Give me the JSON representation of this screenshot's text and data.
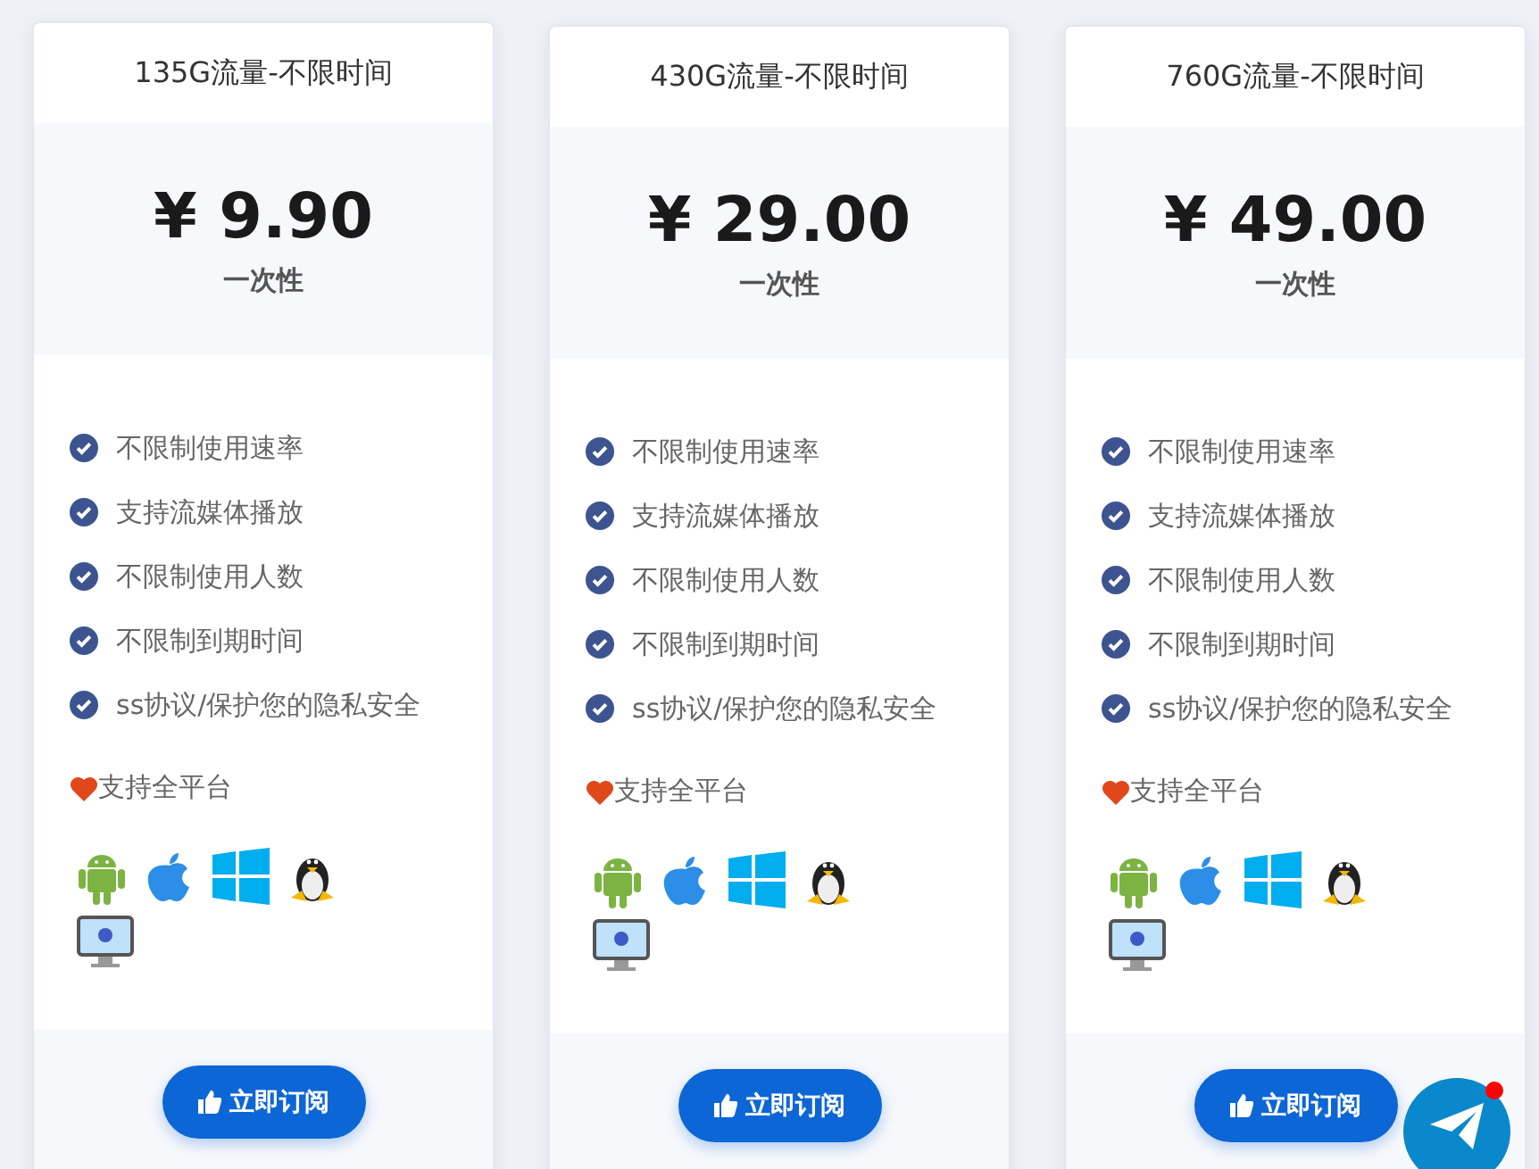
{
  "plans": [
    {
      "title": "135G流量-不限时间",
      "price": "¥ 9.90",
      "period": "一次性",
      "features": [
        "不限制使用速率",
        "支持流媒体播放",
        "不限制使用人数",
        "不限制到期时间",
        "ss协议/保护您的隐私安全"
      ],
      "platform_label": "支持全平台",
      "button": "立即订阅"
    },
    {
      "title": "430G流量-不限时间",
      "price": "¥ 29.00",
      "period": "一次性",
      "features": [
        "不限制使用速率",
        "支持流媒体播放",
        "不限制使用人数",
        "不限制到期时间",
        "ss协议/保护您的隐私安全"
      ],
      "platform_label": "支持全平台",
      "button": "立即订阅"
    },
    {
      "title": "760G流量-不限时间",
      "price": "¥ 49.00",
      "period": "一次性",
      "features": [
        "不限制使用速率",
        "支持流媒体播放",
        "不限制使用人数",
        "不限制到期时间",
        "ss协议/保护您的隐私安全"
      ],
      "platform_label": "支持全平台",
      "button": "立即订阅"
    }
  ],
  "chat_button": {
    "unread": true
  }
}
